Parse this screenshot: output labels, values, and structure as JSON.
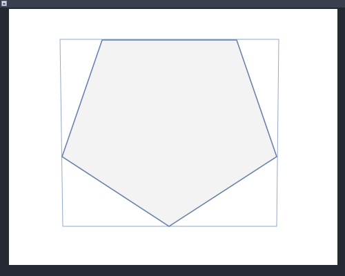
{
  "window": {
    "title": "",
    "app_icon": "document-icon"
  },
  "drawing": {
    "shape": "pentagon",
    "fill_color": "#f3f3f3",
    "stroke_color": "#6a82ad",
    "bounding_box_color": "#8fa8cf"
  }
}
